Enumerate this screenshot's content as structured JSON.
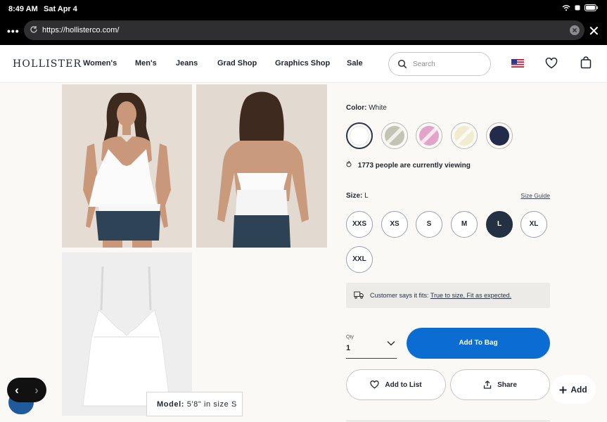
{
  "status": {
    "time": "8:49 AM",
    "date": "Sat Apr 4"
  },
  "browser": {
    "url": "https://hollisterco.com/"
  },
  "nav": {
    "logo": "HOLLISTER",
    "links": [
      "Women's",
      "Men's",
      "Jeans",
      "Grad Shop",
      "Graphics Shop",
      "Sale"
    ],
    "search_placeholder": "Search"
  },
  "gallery": {
    "model_label": "Model:",
    "model_value": "5'8\" in size S"
  },
  "product": {
    "color_label": "Color:",
    "color_value": "White",
    "swatches": [
      "#ffffff",
      "#c3c4b4",
      "#e2a5c9",
      "#f1ecd0",
      "#222b49"
    ],
    "viewing": "1773 people are currently viewing",
    "size_label": "Size:",
    "size_value": "L",
    "size_guide": "Size Guide",
    "sizes": [
      "XXS",
      "XS",
      "S",
      "M",
      "L",
      "XL",
      "XXL"
    ],
    "selected_size": "L",
    "fit_prefix": "Customer says it fits:",
    "fit_value": "True to size, Fit as expected.",
    "qty_label": "Qty",
    "qty_value": "1",
    "add_to_bag": "Add To Bag",
    "add_to_list": "Add to List",
    "share": "Share"
  },
  "fab": {
    "add": "Add"
  },
  "colors": {
    "primary": "#0b6cd1",
    "selected_size": "#233142"
  }
}
